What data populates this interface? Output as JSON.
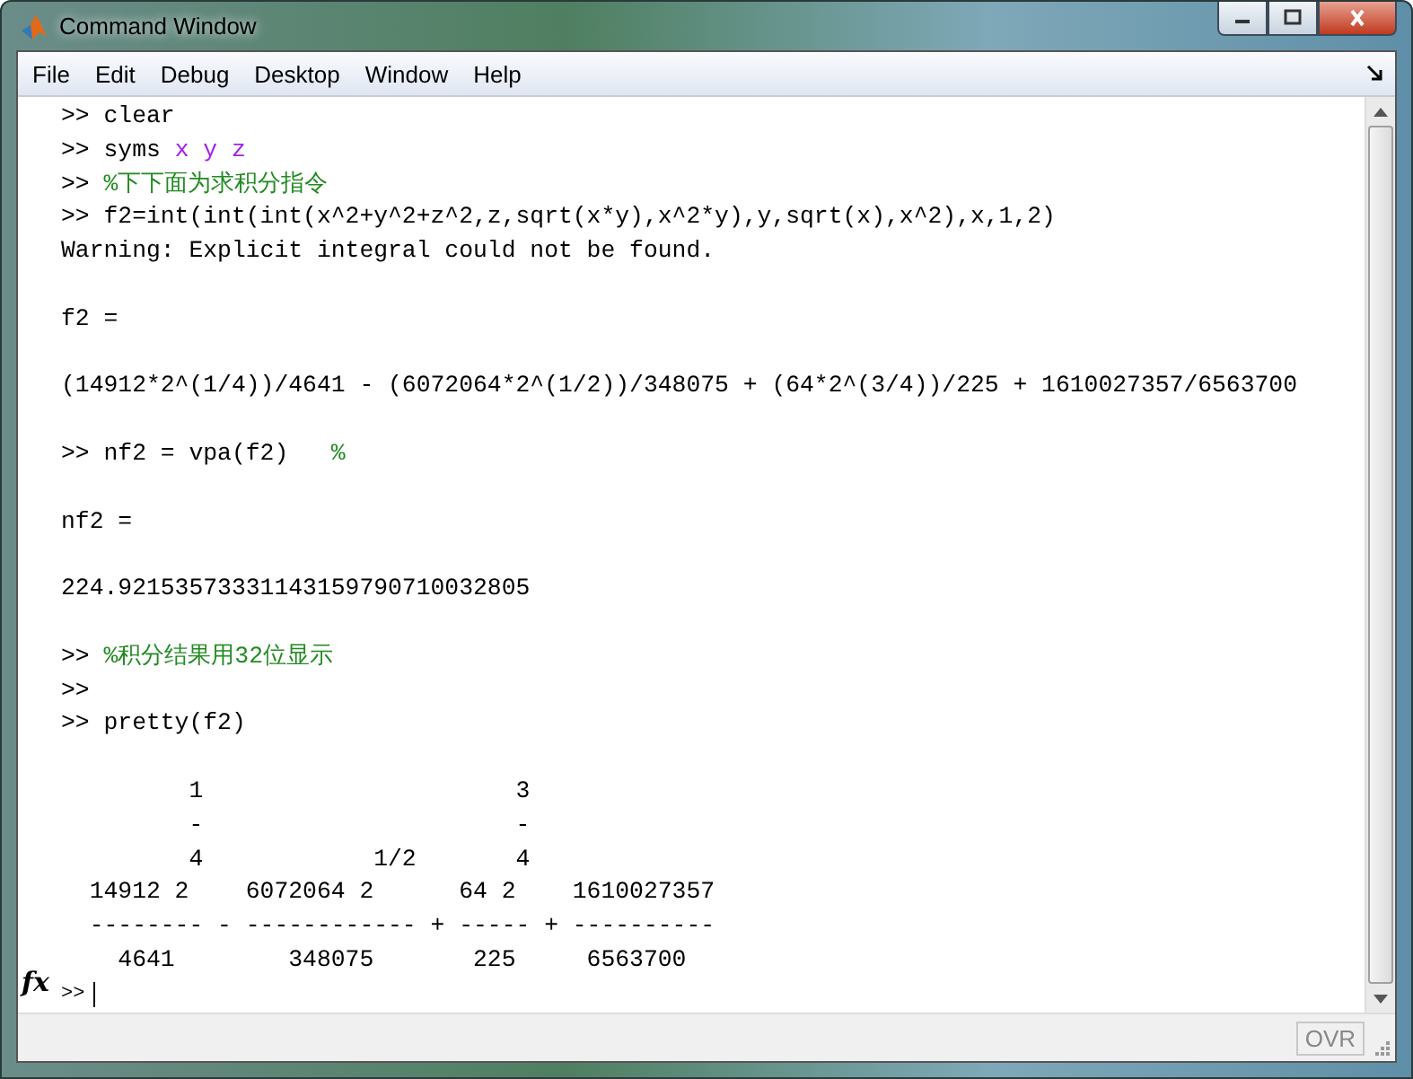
{
  "window": {
    "title": "Command Window"
  },
  "menu": [
    {
      "label": "File"
    },
    {
      "label": "Edit"
    },
    {
      "label": "Debug"
    },
    {
      "label": "Desktop"
    },
    {
      "label": "Window"
    },
    {
      "label": "Help"
    }
  ],
  "console": {
    "lines": [
      {
        "segments": [
          {
            "kind": "prompt",
            "text": ">>"
          },
          {
            "kind": "code",
            "text": " clear"
          }
        ]
      },
      {
        "segments": [
          {
            "kind": "prompt",
            "text": ">>"
          },
          {
            "kind": "code",
            "text": " syms "
          },
          {
            "kind": "string",
            "text": "x y z"
          }
        ]
      },
      {
        "segments": [
          {
            "kind": "prompt",
            "text": ">>"
          },
          {
            "kind": "comment",
            "text": " %下下面为求积分指令"
          }
        ]
      },
      {
        "segments": [
          {
            "kind": "prompt",
            "text": ">>"
          },
          {
            "kind": "code",
            "text": " f2=int(int(int(x^2+y^2+z^2,z,sqrt(x*y),x^2*y),y,sqrt(x),x^2),x,1,2)"
          }
        ]
      },
      {
        "segments": [
          {
            "kind": "code",
            "text": "Warning: Explicit integral could not be found."
          }
        ]
      },
      {
        "kind": "blank"
      },
      {
        "segments": [
          {
            "kind": "code",
            "text": "f2 ="
          }
        ]
      },
      {
        "kind": "blank"
      },
      {
        "segments": [
          {
            "kind": "code",
            "text": "(14912*2^(1/4))/4641 - (6072064*2^(1/2))/348075 + (64*2^(3/4))/225 + 1610027357/6563700"
          }
        ]
      },
      {
        "kind": "blank"
      },
      {
        "segments": [
          {
            "kind": "prompt",
            "text": ">>"
          },
          {
            "kind": "code",
            "text": " nf2 = vpa(f2)   "
          },
          {
            "kind": "comment",
            "text": "%"
          }
        ]
      },
      {
        "kind": "blank"
      },
      {
        "segments": [
          {
            "kind": "code",
            "text": "nf2 ="
          }
        ]
      },
      {
        "kind": "blank"
      },
      {
        "segments": [
          {
            "kind": "code",
            "text": "224.92153573331143159790710032805"
          }
        ]
      },
      {
        "kind": "blank"
      },
      {
        "segments": [
          {
            "kind": "prompt",
            "text": ">>"
          },
          {
            "kind": "comment",
            "text": " %积分结果用32位显示"
          }
        ]
      },
      {
        "segments": [
          {
            "kind": "prompt",
            "text": ">>"
          }
        ]
      },
      {
        "segments": [
          {
            "kind": "prompt",
            "text": ">>"
          },
          {
            "kind": "code",
            "text": " pretty(f2)"
          }
        ]
      },
      {
        "kind": "blank"
      },
      {
        "segments": [
          {
            "kind": "code",
            "text": "         1                      3"
          }
        ]
      },
      {
        "segments": [
          {
            "kind": "code",
            "text": "         -                      -"
          }
        ]
      },
      {
        "segments": [
          {
            "kind": "code",
            "text": "         4            1/2       4"
          }
        ]
      },
      {
        "segments": [
          {
            "kind": "code",
            "text": "  14912 2    6072064 2      64 2    1610027357"
          }
        ]
      },
      {
        "segments": [
          {
            "kind": "code",
            "text": "  -------- - ------------ + ----- + ----------"
          }
        ]
      },
      {
        "segments": [
          {
            "kind": "code",
            "text": "    4641        348075       225     6563700"
          }
        ]
      }
    ],
    "input_prompt": ">>",
    "function_button": "fx"
  },
  "status_bar": {
    "mode": "OVR"
  }
}
